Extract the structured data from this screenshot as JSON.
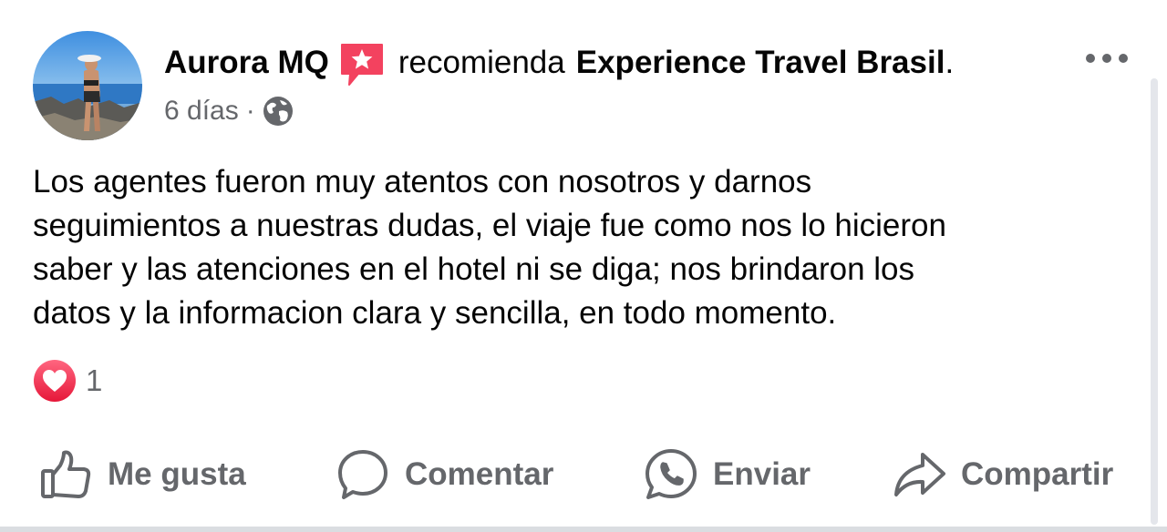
{
  "post": {
    "author": "Aurora MQ",
    "action": "recomienda",
    "page": "Experience Travel Brasil",
    "period": ".",
    "time": "6 días",
    "separator": "·",
    "audience_icon": "globe-icon",
    "recommend_icon": "recommendation-star-icon",
    "text_lines": [
      "Los agentes fueron muy atentos con nosotros y darnos",
      "seguimientos a nuestras dudas, el viaje fue como nos lo hicieron",
      "saber y las atenciones en el hotel ni se diga; nos brindaron los",
      "datos y la informacion clara y sencilla, en todo momento."
    ]
  },
  "reactions": {
    "icon": "love-reaction-icon",
    "count": "1"
  },
  "actions": {
    "like": "Me gusta",
    "comment": "Comentar",
    "send": "Enviar",
    "share": "Compartir"
  },
  "colors": {
    "text": "#050505",
    "secondary": "#65676b",
    "recommend_red": "#f3425f",
    "love_red": "#f33e58"
  }
}
